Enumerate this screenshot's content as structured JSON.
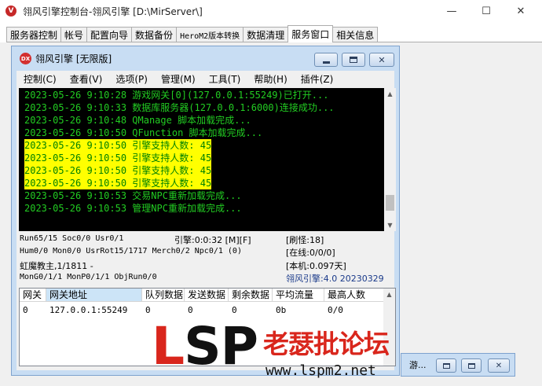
{
  "outer_window": {
    "title": "翎风引擎控制台-翎风引擎 [D:\\MirServer\\]",
    "logo_glyph": "V",
    "controls": {
      "minimize": "—",
      "maximize": "☐",
      "close": "✕"
    }
  },
  "outer_tabs": [
    {
      "label": "服务器控制"
    },
    {
      "label": "帐号"
    },
    {
      "label": "配置向导"
    },
    {
      "label": "数据备份"
    },
    {
      "label": "HeroM2版本转换"
    },
    {
      "label": "数据清理"
    },
    {
      "label": "服务窗口",
      "active": true
    },
    {
      "label": "相关信息"
    }
  ],
  "inner_window": {
    "title": "翎风引擎 [无限版]",
    "logo_glyph": "DX",
    "menu": [
      "控制(C)",
      "查看(V)",
      "选项(P)",
      "管理(M)",
      "工具(T)",
      "帮助(H)",
      "插件(Z)"
    ]
  },
  "log_lines": [
    {
      "text": "2023-05-26 9:10:28 游戏网关[0](127.0.0.1:55249)已打开...",
      "highlight": false
    },
    {
      "text": "2023-05-26 9:10:33 数据库服务器(127.0.0.1:6000)连接成功...",
      "highlight": false
    },
    {
      "text": "2023-05-26 9:10:48 QManage 脚本加载完成...",
      "highlight": false
    },
    {
      "text": "2023-05-26 9:10:50 QFunction 脚本加载完成...",
      "highlight": false
    },
    {
      "text": "2023-05-26 9:10:50 引擎支持人数: 45",
      "highlight": true
    },
    {
      "text": "2023-05-26 9:10:50 引擎支持人数: 45",
      "highlight": true
    },
    {
      "text": "2023-05-26 9:10:50 引擎支持人数: 45",
      "highlight": true
    },
    {
      "text": "2023-05-26 9:10:50 引擎支持人数: 45",
      "highlight": true
    },
    {
      "text": "2023-05-26 9:10:53 交易NPC重新加载完成...",
      "highlight": false
    },
    {
      "text": "2023-05-26 9:10:53 管理NPC重新加载完成...",
      "highlight": false
    }
  ],
  "stats": {
    "run": "Run65/15 Soc0/0 Usr0/1",
    "engine_time": "引擎:0:0:32 [M][F]",
    "refresh": "[刷怪:18]",
    "hum": "Hum0/0 Mon0/0 UsrRot15/1717 Merch0/2 Npc0/1 (0)",
    "online": "[在线:0/0/0]",
    "boss": "虹魔教主,1/1811 -",
    "local": "[本机:0.097天]",
    "mon": "MonG0/1/1 MonP0/1/1 ObjRun0/0",
    "version": "翎风引擎:4.0 20230329"
  },
  "gateway_table": {
    "columns": [
      "网关",
      "网关地址",
      "队列数据",
      "发送数据",
      "剩余数据",
      "平均流量",
      "最高人数"
    ],
    "rows": [
      [
        "0",
        "127.0.0.1:55249",
        "0",
        "0",
        "0",
        "0b",
        "0/0"
      ]
    ]
  },
  "minimized_window": {
    "label": "游..."
  },
  "watermark": {
    "logo_l": "L",
    "logo_sp": "SP",
    "title": "老瑟批论坛",
    "url": "www.lspm2.net"
  },
  "colors": {
    "console_text": "#22cc22",
    "highlight_bg": "#ffff00",
    "highlight_text": "#008000",
    "watermark_red": "#d9261c"
  }
}
